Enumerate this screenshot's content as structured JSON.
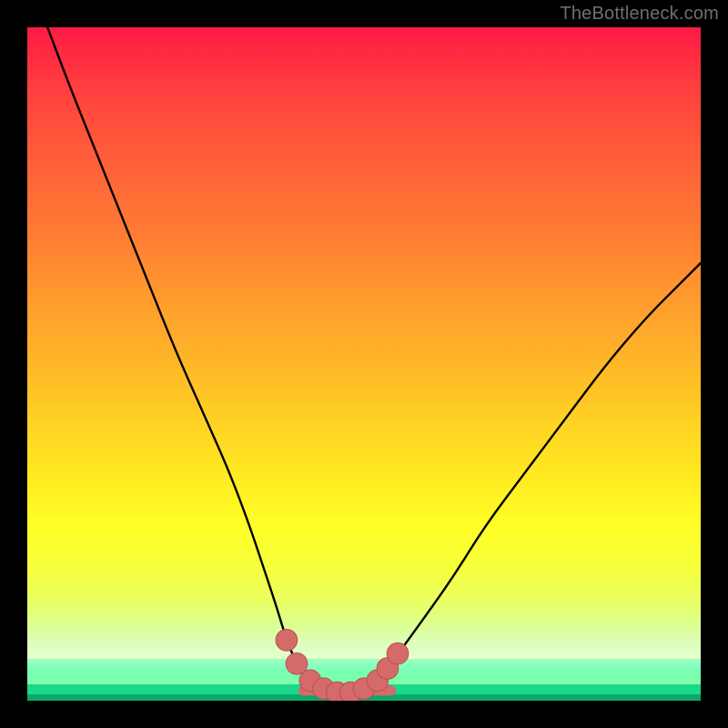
{
  "watermark": {
    "text": "TheBottleneck.com"
  },
  "colors": {
    "curve": "#000000",
    "marker_fill": "#d46a6a",
    "marker_stroke": "#b94f4f",
    "bg_black": "#000000"
  },
  "chart_data": {
    "type": "line",
    "title": "",
    "xlabel": "",
    "ylabel": "",
    "xlim": [
      0,
      100
    ],
    "ylim": [
      0,
      100
    ],
    "grid": false,
    "legend": false,
    "series": [
      {
        "name": "bottleneck-curve",
        "x": [
          3,
          6,
          10,
          14,
          18,
          22,
          26,
          30,
          33,
          35,
          37,
          38.5,
          40,
          42,
          44,
          46,
          48,
          50,
          52,
          54,
          58,
          63,
          68,
          74,
          80,
          86,
          92,
          97,
          100
        ],
        "y": [
          100,
          92,
          82,
          72,
          62,
          52,
          43,
          34,
          26,
          20,
          14,
          9,
          5.5,
          3,
          1.8,
          1.2,
          1.2,
          1.8,
          3,
          5.5,
          11,
          18,
          26,
          34,
          42,
          50,
          57,
          62,
          65
        ]
      }
    ],
    "markers": [
      {
        "x": 38.5,
        "y": 9.0,
        "r": 1.6
      },
      {
        "x": 40.0,
        "y": 5.5,
        "r": 1.6
      },
      {
        "x": 42.0,
        "y": 3.0,
        "r": 1.6
      },
      {
        "x": 44.0,
        "y": 1.8,
        "r": 1.6
      },
      {
        "x": 46.0,
        "y": 1.2,
        "r": 1.6
      },
      {
        "x": 48.0,
        "y": 1.2,
        "r": 1.6
      },
      {
        "x": 50.0,
        "y": 1.8,
        "r": 1.6
      },
      {
        "x": 52.0,
        "y": 3.0,
        "r": 1.6
      },
      {
        "x": 53.5,
        "y": 4.8,
        "r": 1.6
      },
      {
        "x": 55.0,
        "y": 7.0,
        "r": 1.6
      }
    ],
    "floor_segment": {
      "x0": 41,
      "x1": 54,
      "y": 1.5
    }
  }
}
